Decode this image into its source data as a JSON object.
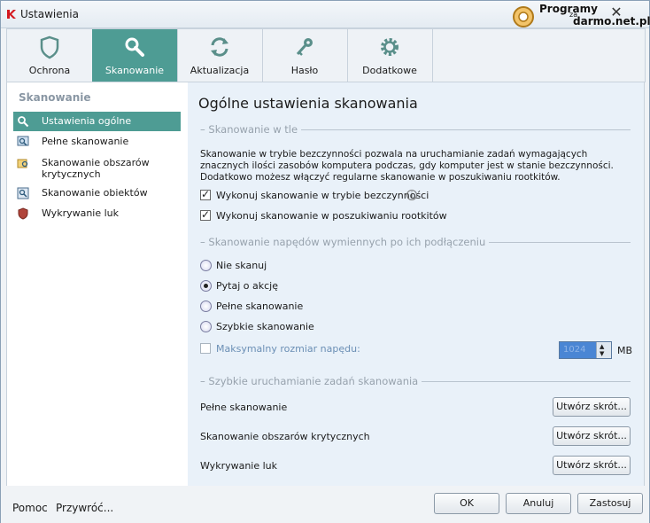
{
  "window": {
    "title": "Ustawienia",
    "close": "✕"
  },
  "watermark": {
    "line1": "Programy",
    "line2": "za",
    "line3": "darmo.net.pl"
  },
  "tabs": [
    {
      "label": "Ochrona",
      "icon": "shield-icon"
    },
    {
      "label": "Skanowanie",
      "icon": "magnifier-icon",
      "active": true
    },
    {
      "label": "Aktualizacja",
      "icon": "refresh-icon"
    },
    {
      "label": "Hasło",
      "icon": "key-icon"
    },
    {
      "label": "Dodatkowe",
      "icon": "gear-icon"
    }
  ],
  "sidebar": {
    "header": "Skanowanie",
    "items": [
      {
        "label": "Ustawienia ogólne",
        "icon": "magnifier-icon",
        "active": true
      },
      {
        "label": "Pełne skanowanie",
        "icon": "full-scan-icon"
      },
      {
        "label": "Skanowanie obszarów krytycznych",
        "icon": "critical-areas-icon"
      },
      {
        "label": "Skanowanie obiektów",
        "icon": "objects-scan-icon"
      },
      {
        "label": "Wykrywanie luk",
        "icon": "vulnerability-icon"
      }
    ]
  },
  "main": {
    "title": "Ogólne ustawienia skanowania",
    "background_scan": {
      "heading": "Skanowanie w tle",
      "description": "Skanowanie w trybie bezczynności pozwala na uruchamianie zadań wymagających znacznych ilości zasobów komputera podczas, gdy komputer jest w stanie bezczynności. Dodatkowo możesz włączyć regularne skanowanie w poszukiwaniu rootkitów.",
      "idle_scan_label": "Wykonuj skanowanie w trybie bezczynności",
      "idle_scan_checked": true,
      "rootkit_scan_label": "Wykonuj skanowanie w poszukiwaniu rootkitów",
      "rootkit_scan_checked": true
    },
    "removable": {
      "heading": "Skanowanie napędów wymiennych po ich podłączeniu",
      "options": [
        "Nie skanuj",
        "Pytaj o akcję",
        "Pełne skanowanie",
        "Szybkie skanowanie"
      ],
      "selected": "Pytaj o akcję",
      "max_size_label": "Maksymalny rozmiar napędu:",
      "max_size_checked": false,
      "max_size_value": "1024",
      "max_size_unit": "MB"
    },
    "shortcuts": {
      "heading": "Szybkie uruchamianie zadań skanowania",
      "rows": [
        {
          "label": "Pełne skanowanie",
          "button": "Utwórz skrót..."
        },
        {
          "label": "Skanowanie obszarów krytycznych",
          "button": "Utwórz skrót..."
        },
        {
          "label": "Wykrywanie luk",
          "button": "Utwórz skrót..."
        }
      ]
    }
  },
  "footer": {
    "help": "Pomoc",
    "restore": "Przywróć...",
    "ok": "OK",
    "cancel": "Anuluj",
    "apply": "Zastosuj"
  },
  "colors": {
    "accent": "#4e9c94",
    "panel": "#e9f1f9",
    "disabled_text": "#6b8fb5"
  }
}
